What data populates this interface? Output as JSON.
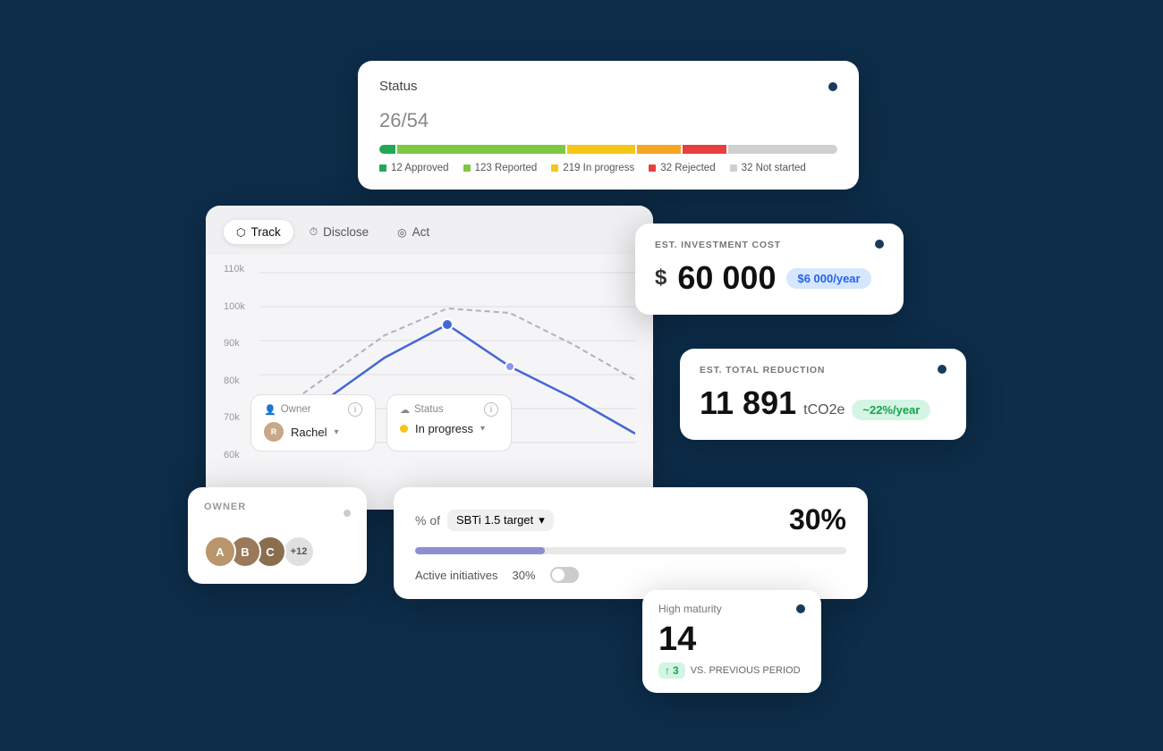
{
  "background": "#0d2d4a",
  "statusCard": {
    "title": "Status",
    "count": "26",
    "total": "/54",
    "legend": [
      {
        "label": "12 Approved",
        "color": "#22a855"
      },
      {
        "label": "123 Reported",
        "color": "#7dc742"
      },
      {
        "label": "219 In progress",
        "color": "#f5c518"
      },
      {
        "label": "32 Rejected",
        "color": "#e84040"
      },
      {
        "label": "32 Not started",
        "color": "#d0d0d0"
      }
    ]
  },
  "tabs": [
    {
      "label": "Track",
      "icon": "⬡",
      "active": true
    },
    {
      "label": "Disclose",
      "icon": "⏱",
      "active": false
    },
    {
      "label": "Act",
      "icon": "◎",
      "active": false
    }
  ],
  "yAxis": [
    "110k",
    "100k",
    "90k",
    "80k",
    "70k",
    "60k"
  ],
  "ownerFilter": {
    "label": "Owner",
    "value": "Rachel"
  },
  "statusFilter": {
    "label": "Status",
    "value": "In progress"
  },
  "investCard": {
    "label": "EST. INVESTMENT COST",
    "amount": "60 000",
    "currency": "$",
    "badge": "$6 000/year"
  },
  "reductionCard": {
    "label": "EST. TOTAL REDUCTION",
    "amount": "11 891",
    "unit": "tCO2e",
    "badge": "~22%/year"
  },
  "ownerCard": {
    "label": "OWNER",
    "extra": "+12"
  },
  "percentCard": {
    "prefix": "% of",
    "select": "SBTi 1.5 target",
    "value": "30%",
    "progressWidth": "30",
    "footer": {
      "label": "Active initiatives",
      "toggleValue": "30%"
    }
  },
  "maturityCard": {
    "label": "High maturity",
    "value": "14",
    "vsBadge": "↑ 3",
    "vsLabel": "VS. PREVIOUS PERIOD"
  }
}
